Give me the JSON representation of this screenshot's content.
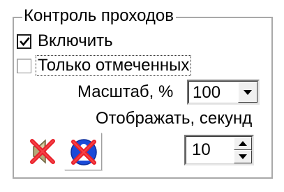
{
  "group": {
    "title": "Контроль проходов"
  },
  "options": {
    "enable": {
      "label": "Включить",
      "checked": true
    },
    "only_marked": {
      "label": "Только отмеченных",
      "checked": false,
      "focused": true
    }
  },
  "scale": {
    "label": "Масштаб, %",
    "value": "100"
  },
  "display_seconds": {
    "label": "Отображать, секунд",
    "value": "10"
  },
  "icons": {
    "sound": "speaker-muted-icon",
    "person": "person-disabled-icon"
  },
  "colors": {
    "cross": "#e8202a",
    "globe_blue": "#1a4ad8",
    "speaker": "#a89a6a",
    "frame": "#a9a9a9"
  }
}
